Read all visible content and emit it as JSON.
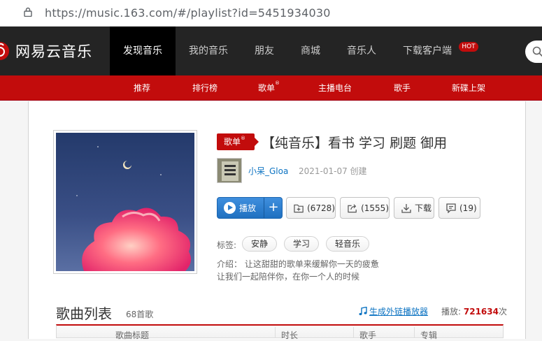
{
  "browser": {
    "url": "https://music.163.com/#/playlist?id=5451934030"
  },
  "brand": {
    "name": "网易云音乐",
    "accent": "#c20c0c"
  },
  "topnav": {
    "items": [
      "发现音乐",
      "我的音乐",
      "朋友",
      "商城",
      "音乐人",
      "下载客户端"
    ],
    "active": "发现音乐",
    "hot_badge": "HOT"
  },
  "subnav": {
    "items": [
      "推荐",
      "排行榜",
      "歌单",
      "主播电台",
      "歌手",
      "新碟上架"
    ],
    "registered_mark": "®"
  },
  "playlist": {
    "tag": "歌单",
    "tag_mark": "®",
    "title": "【纯音乐】看书 学习 刷题 御用",
    "creator": "小呆_Gloa",
    "created": "2021-01-07 创建",
    "buttons": {
      "play": "播放",
      "add": "+",
      "collect": "(6728)",
      "share": "(1555)",
      "download": "下载",
      "comment": "(19)"
    },
    "tags_label": "标签:",
    "tags": [
      "安静",
      "学习",
      "轻音乐"
    ],
    "intro_line1": "介绍：  让这甜甜的歌单来缓解你一天的疲惫",
    "intro_line2": "让我们一起陪伴你，在你一个人的时候"
  },
  "song_list": {
    "title": "歌曲列表",
    "count": "68首歌",
    "outlink": "生成外链播放器",
    "play_label": "播放:",
    "play_count": "721634",
    "play_unit": "次",
    "columns": [
      "歌曲标题",
      "时长",
      "歌手",
      "专辑"
    ]
  },
  "icons": [
    "lock-icon",
    "logo-icon",
    "search-icon",
    "play-icon",
    "collect-icon",
    "share-icon",
    "download-icon",
    "comment-icon",
    "music-note-icon"
  ]
}
